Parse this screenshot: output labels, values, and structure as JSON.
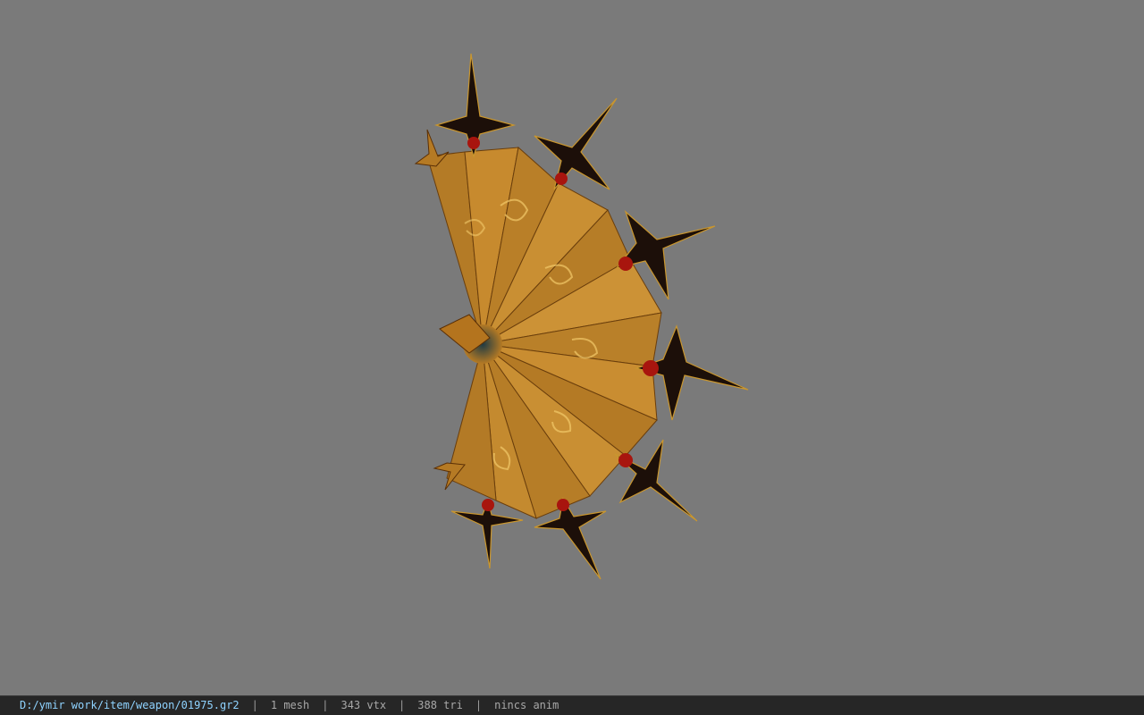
{
  "viewer": {
    "background_color": "#7a7a7a",
    "model_icon": "ornate-golden-fan-weapon-model"
  },
  "status_bar": {
    "file_path": "D:/ymir work/item/weapon/01975.gr2",
    "separator": "|",
    "mesh_count": "1 mesh",
    "vertex_count": "343 vtx",
    "triangle_count": "388 tri",
    "animation": "nincs anim",
    "path_color": "#8fd3ff",
    "background_color": "#262626"
  }
}
